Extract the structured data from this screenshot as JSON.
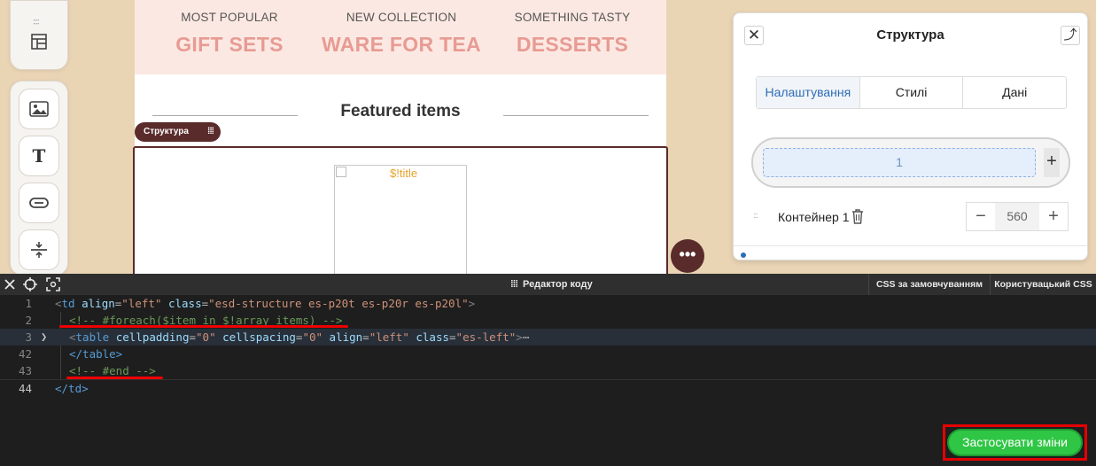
{
  "toolbar": {
    "items": [
      "image-block",
      "text-block",
      "button-block",
      "spacer-block"
    ]
  },
  "email": {
    "categories": [
      {
        "small": "MOST POPULAR",
        "big": "GIFT SETS"
      },
      {
        "small": "NEW COLLECTION",
        "big": "WARE FOR TEA"
      },
      {
        "small": "SOMETHING TASTY",
        "big": "DESSERTS"
      }
    ],
    "featured": "Featured items",
    "structure_pill": "Структура",
    "image_alt": "$!title",
    "colors": {
      "category_bg": "#fce8e2",
      "category_text": "#e79b93",
      "accent": "#5a2b2b"
    }
  },
  "panel": {
    "title": "Структура",
    "tabs": [
      "Налаштування",
      "Стилі",
      "Дані"
    ],
    "active_tab": "Налаштування",
    "columns_value": "1",
    "container_label": "Контейнер 1",
    "container_width": "560"
  },
  "editor": {
    "title": "Редактор коду",
    "tab_default_css": "CSS за замовчуванням",
    "tab_custom_css": "Користувацький CSS",
    "line_numbers": [
      "1",
      "2",
      "3",
      "42",
      "43",
      "44"
    ],
    "lines": [
      {
        "kind": "td-open",
        "t1": "<",
        "tag": "td",
        "a1": " align",
        "eq1": "=",
        "v1": "\"left\"",
        "a2": " class",
        "eq2": "=",
        "v2": "\"esd-structure es-p20t es-p20r es-p20l\"",
        "t2": ">"
      },
      {
        "kind": "comment",
        "text": "<!-- #foreach($item in $!array_items) -->"
      },
      {
        "kind": "table-open",
        "t1": "<",
        "tag": "table",
        "a1": " cellpadding",
        "eq1": "=",
        "v1": "\"0\"",
        "a2": " cellspacing",
        "eq2": "=",
        "v2": "\"0\"",
        "a3": " align",
        "eq3": "=",
        "v3": "\"left\"",
        "a4": " class",
        "eq4": "=",
        "v4": "\"es-left\"",
        "t2": ">",
        "ellipsis": "⋯"
      },
      {
        "kind": "close",
        "text": "</table>"
      },
      {
        "kind": "comment",
        "text": "<!-- #end -->"
      },
      {
        "kind": "close",
        "text": "</td>"
      }
    ],
    "apply_label": "Застосувати зміни"
  }
}
